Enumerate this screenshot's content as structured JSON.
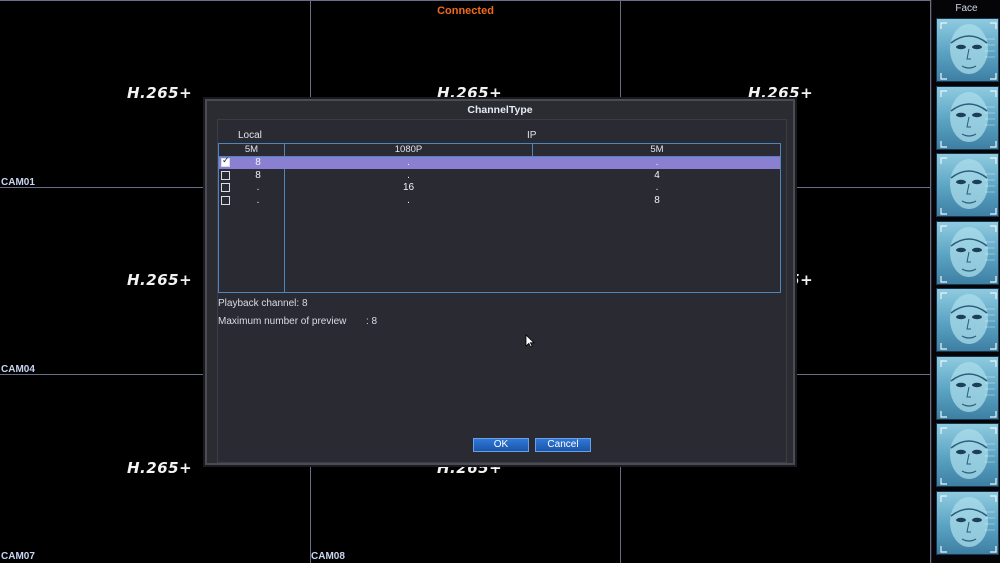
{
  "status": {
    "text": "Connected",
    "color": "#f26a1b"
  },
  "grid": {
    "codec_label": "H.265+",
    "cameras": [
      "CAM01",
      "CAM04",
      "CAM07",
      "CAM08"
    ]
  },
  "face_panel": {
    "title": "Face",
    "thumbnail_count": 8,
    "thumbnail_icon": "face-recognition-thumbnail"
  },
  "dialog": {
    "title": "ChannelType",
    "groups": {
      "local": "Local",
      "ip": "IP"
    },
    "columns": [
      "5M",
      "1080P",
      "5M"
    ],
    "rows": [
      {
        "checked": true,
        "local_5m": "8",
        "ip_1080p": ".",
        "ip_5m": "."
      },
      {
        "checked": false,
        "local_5m": "8",
        "ip_1080p": ".",
        "ip_5m": "4"
      },
      {
        "checked": false,
        "local_5m": ".",
        "ip_1080p": "16",
        "ip_5m": "."
      },
      {
        "checked": false,
        "local_5m": ".",
        "ip_1080p": ".",
        "ip_5m": "8"
      }
    ],
    "playback_channel": "Playback channel: 8",
    "max_preview_label": "Maximum number of preview",
    "max_preview_value": ": 8",
    "ok_label": "OK",
    "cancel_label": "Cancel"
  }
}
